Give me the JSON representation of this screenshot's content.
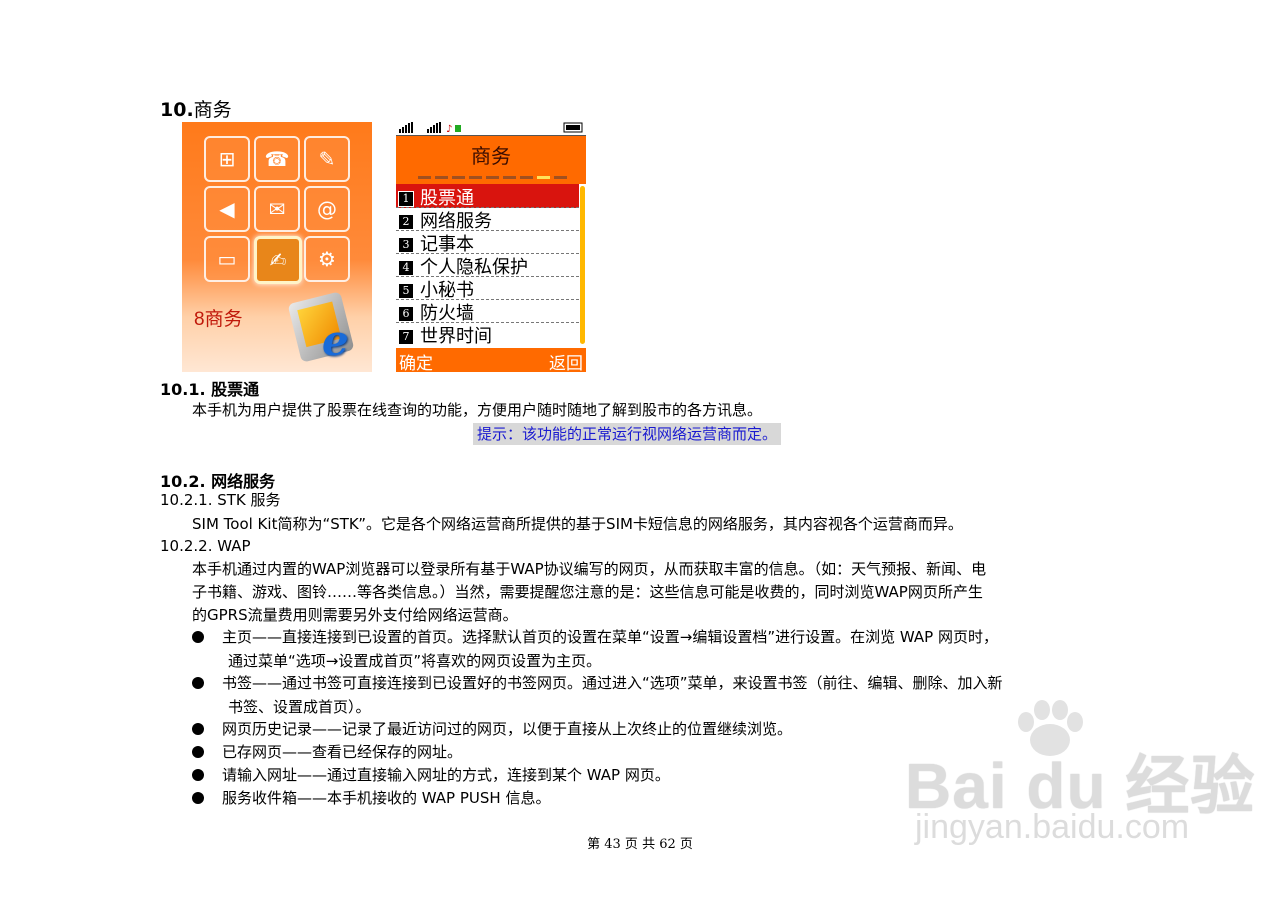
{
  "section": {
    "number": "10.",
    "title": "商务"
  },
  "grid_screen": {
    "label": "8商务",
    "icons": [
      "grid-icon",
      "phonebook-icon",
      "notes-icon",
      "speaker-icon",
      "envelope-icon",
      "internet-icon",
      "briefcase-icon",
      "business-icon",
      "gear-icon"
    ]
  },
  "menu_screen": {
    "title": "商务",
    "items": [
      {
        "num": "1",
        "label": "股票通"
      },
      {
        "num": "2",
        "label": "网络服务"
      },
      {
        "num": "3",
        "label": "记事本"
      },
      {
        "num": "4",
        "label": "个人隐私保护"
      },
      {
        "num": "5",
        "label": "小秘书"
      },
      {
        "num": "6",
        "label": "防火墙"
      },
      {
        "num": "7",
        "label": "世界时间"
      }
    ],
    "left_soft": "确定",
    "right_soft": "返回"
  },
  "s101": {
    "heading": "10.1.   股票通",
    "body": "本手机为用户提供了股票在线查询的功能，方便用户随时随地了解到股市的各方讯息。",
    "tip": "提示：该功能的正常运行视网络运营商而定。"
  },
  "s102": {
    "heading": "10.2.   网络服务",
    "stk_heading": "10.2.1. STK 服务",
    "stk_body": "SIM Tool Kit简称为“STK”。它是各个网络运营商所提供的基于SIM卡短信息的网络服务，其内容视各个运营商而异。",
    "wap_heading": "10.2.2. WAP",
    "wap_body_1": "本手机通过内置的WAP浏览器可以登录所有基于WAP协议编写的网页，从而获取丰富的信息。（如：天气预报、新闻、电",
    "wap_body_2": "子书籍、游戏、图铃……等各类信息。）当然，需要提醒您注意的是：这些信息可能是收费的，同时浏览WAP网页所产生",
    "wap_body_3": "的GPRS流量费用则需要另外支付给网络运营商。",
    "bullets": [
      {
        "l1": "主页——直接连接到已设置的首页。选择默认首页的设置在菜单“设置→编辑设置档”进行设置。在浏览 WAP 网页时，",
        "l2": "通过菜单“选项→设置成首页”将喜欢的网页设置为主页。"
      },
      {
        "l1": "书签——通过书签可直接连接到已设置好的书签网页。通过进入“选项”菜单，来设置书签（前往、编辑、删除、加入新",
        "l2": "书签、设置成首页）。"
      },
      {
        "l1": "网页历史记录——记录了最近访问过的网页，以便于直接从上次终止的位置继续浏览。",
        "l2": ""
      },
      {
        "l1": "已存网页——查看已经保存的网址。",
        "l2": ""
      },
      {
        "l1": "请输入网址——通过直接输入网址的方式，连接到某个 WAP 网页。",
        "l2": ""
      },
      {
        "l1": "服务收件箱——本手机接收的 WAP PUSH 信息。",
        "l2": ""
      }
    ]
  },
  "footer": "第 43 页 共 62 页",
  "watermark": {
    "brand": "Bai du 经验",
    "url": "jingyan.baidu.com"
  }
}
